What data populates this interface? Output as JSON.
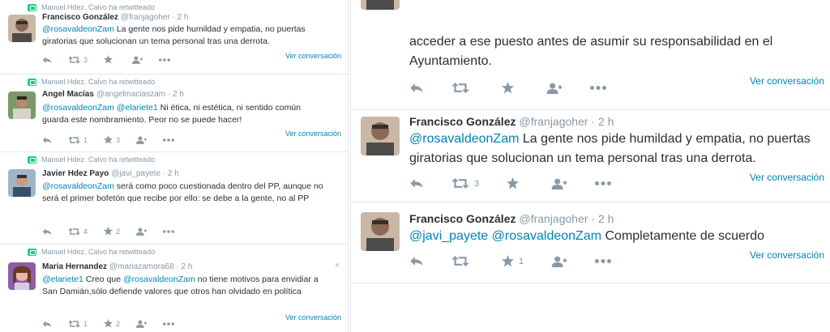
{
  "colors": {
    "link": "#0084b4",
    "muted": "#8899a6",
    "text": "#292f33",
    "retweet": "#19cf86",
    "divider": "#e1e8ed"
  },
  "icons": [
    "retweeted-icon",
    "reply-icon",
    "retweet-icon",
    "favorite-icon",
    "follow-icon",
    "more-icon",
    "location-icon"
  ],
  "left_tweets": [
    {
      "retweeted_by": "Manuel Hdez. Calvo ha retwitteado",
      "name": "Francisco González",
      "meta": "@franjagoher · 2 h",
      "mention": "@rosavaldeonZam",
      "text": " La gente nos pide humildad y empatia, no puertas giratorias que solucionan un tema personal tras una derrota.",
      "retweets": "3",
      "favorites": "",
      "ver": "Ver conversación"
    },
    {
      "retweeted_by": "Manuel Hdez. Calvo ha retwitteado",
      "name": "Angel Macías",
      "meta": "@angelmaciaszam · 2 h",
      "mention": "@rosavaldeonZam @elariete1",
      "text": " Ni ética, ni estética, ni sentido común guarda este nombramiento. Peor no se puede hacer!",
      "retweets": "1",
      "favorites": "3",
      "ver": "Ver conversación"
    },
    {
      "retweeted_by": "Manuel Hdez. Calvo ha retwitteado",
      "name": "Javier Hdez Payo",
      "meta": "@javi_payete · 2 h",
      "mention": "@rosavaldeonZam",
      "text": " será como poco cuestionada dentro del PP, aunque no será el primer bofetón que recibe por ello: se debe a la gente, no al PP",
      "retweets": "4",
      "favorites": "2",
      "ver": ""
    },
    {
      "retweeted_by": "Manuel Hdez. Calvo ha retwitteado",
      "name": "Maria Hernandez",
      "meta": "@mariazamora68 · 2 h",
      "mention": "@elariete1",
      "text_a": " Creo que ",
      "mention_b": "@rosavaldeonZam",
      "text": " no tiene  motivos para envidiar a San Damián,sólo defiende valores que otros  han olvidado en política",
      "retweets": "1",
      "favorites": "2",
      "ver": "Ver conversación"
    }
  ],
  "right_tweets": [
    {
      "text": "acceder a ese puesto antes de asumir su responsabilidad en el Ayuntamiento.",
      "retweets": "",
      "favorites": "",
      "ver": "Ver conversación"
    },
    {
      "name": "Francisco González",
      "meta": "@franjagoher · 2 h",
      "mention": "@rosavaldeonZam",
      "text": " La gente nos pide humildad y empatia, no puertas giratorias que solucionan un tema personal tras una derrota.",
      "retweets": "3",
      "favorites": "",
      "ver": "Ver conversación"
    },
    {
      "name": "Francisco González",
      "meta": "@franjagoher · 2 h",
      "mention": "@javi_payete @rosavaldeonZam",
      "text": " Completamente de scuerdo",
      "retweets": "",
      "favorites": "1",
      "ver": "Ver conversación"
    }
  ]
}
